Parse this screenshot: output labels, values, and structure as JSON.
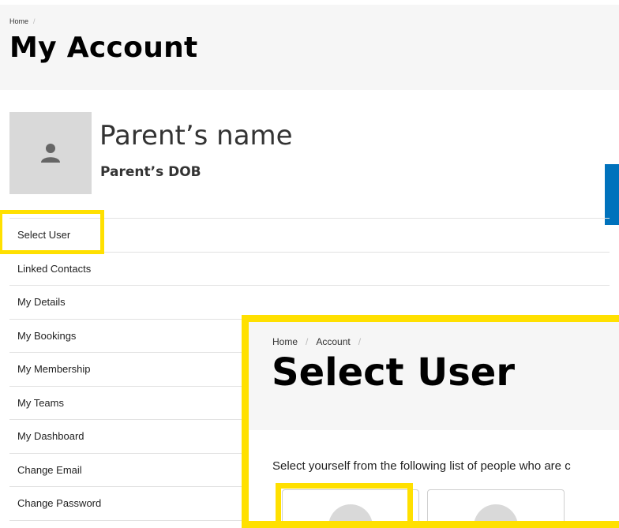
{
  "header": {
    "breadcrumb": [
      "Home"
    ],
    "title": "My Account"
  },
  "profile": {
    "name": "Parent’s name",
    "dob": "Parent’s DOB",
    "avatar_icon": "user-silhouette-icon"
  },
  "menu": {
    "items": [
      {
        "label": "Select User"
      },
      {
        "label": "Linked Contacts"
      },
      {
        "label": "My Details"
      },
      {
        "label": "My Bookings"
      },
      {
        "label": "My Membership"
      },
      {
        "label": "My Teams"
      },
      {
        "label": "My Dashboard"
      },
      {
        "label": "Change Email"
      },
      {
        "label": "Change Password"
      }
    ]
  },
  "overlay": {
    "breadcrumb": [
      "Home",
      "Account"
    ],
    "title": "Select User",
    "intro": "Select yourself from the following list of people who are c"
  },
  "colors": {
    "highlight": "#ffe000",
    "accent_tab": "#0072bc",
    "header_bg": "#f6f6f6",
    "avatar_bg": "#d9d9d9"
  }
}
